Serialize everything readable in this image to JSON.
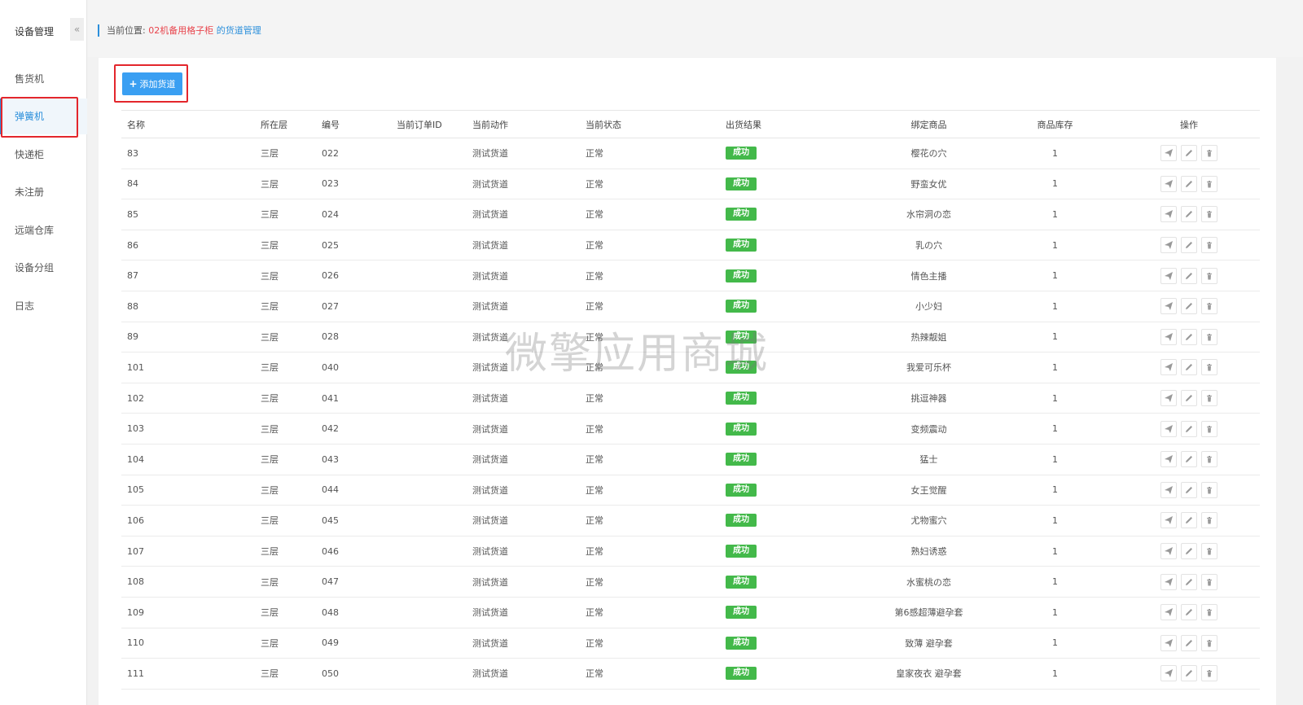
{
  "sidebar": {
    "title": "设备管理",
    "collapse_glyph": "«",
    "items": [
      {
        "label": "售货机"
      },
      {
        "label": "弹簧机"
      },
      {
        "label": "快递柜"
      },
      {
        "label": "未注册"
      },
      {
        "label": "远端仓库"
      },
      {
        "label": "设备分组"
      },
      {
        "label": "日志"
      }
    ],
    "active_index": 1
  },
  "breadcrumb": {
    "label": "当前位置:",
    "device": "02机备用格子柜",
    "page": "的货道管理"
  },
  "toolbar": {
    "add_label": "添加货道"
  },
  "table": {
    "headers": [
      "名称",
      "所在层",
      "编号",
      "当前订单ID",
      "当前动作",
      "当前状态",
      "出货结果",
      "绑定商品",
      "商品库存",
      "操作"
    ],
    "rows": [
      {
        "name": "83",
        "layer": "三层",
        "code": "022",
        "order_id": "",
        "action": "测试货道",
        "status": "正常",
        "result": "成功",
        "product": "樱花の穴",
        "stock": "1"
      },
      {
        "name": "84",
        "layer": "三层",
        "code": "023",
        "order_id": "",
        "action": "测试货道",
        "status": "正常",
        "result": "成功",
        "product": "野蛮女优",
        "stock": "1"
      },
      {
        "name": "85",
        "layer": "三层",
        "code": "024",
        "order_id": "",
        "action": "测试货道",
        "status": "正常",
        "result": "成功",
        "product": "水帘洞の恋",
        "stock": "1"
      },
      {
        "name": "86",
        "layer": "三层",
        "code": "025",
        "order_id": "",
        "action": "测试货道",
        "status": "正常",
        "result": "成功",
        "product": "乳の穴",
        "stock": "1"
      },
      {
        "name": "87",
        "layer": "三层",
        "code": "026",
        "order_id": "",
        "action": "测试货道",
        "status": "正常",
        "result": "成功",
        "product": "情色主播",
        "stock": "1"
      },
      {
        "name": "88",
        "layer": "三层",
        "code": "027",
        "order_id": "",
        "action": "测试货道",
        "status": "正常",
        "result": "成功",
        "product": "小少妇",
        "stock": "1"
      },
      {
        "name": "89",
        "layer": "三层",
        "code": "028",
        "order_id": "",
        "action": "测试货道",
        "status": "正常",
        "result": "成功",
        "product": "热辣靓姐",
        "stock": "1"
      },
      {
        "name": "101",
        "layer": "三层",
        "code": "040",
        "order_id": "",
        "action": "测试货道",
        "status": "正常",
        "result": "成功",
        "product": "我爱可乐杯",
        "stock": "1"
      },
      {
        "name": "102",
        "layer": "三层",
        "code": "041",
        "order_id": "",
        "action": "测试货道",
        "status": "正常",
        "result": "成功",
        "product": "挑逗神器",
        "stock": "1"
      },
      {
        "name": "103",
        "layer": "三层",
        "code": "042",
        "order_id": "",
        "action": "测试货道",
        "status": "正常",
        "result": "成功",
        "product": "变频震动",
        "stock": "1"
      },
      {
        "name": "104",
        "layer": "三层",
        "code": "043",
        "order_id": "",
        "action": "测试货道",
        "status": "正常",
        "result": "成功",
        "product": "猛士",
        "stock": "1"
      },
      {
        "name": "105",
        "layer": "三层",
        "code": "044",
        "order_id": "",
        "action": "测试货道",
        "status": "正常",
        "result": "成功",
        "product": "女王觉醒",
        "stock": "1"
      },
      {
        "name": "106",
        "layer": "三层",
        "code": "045",
        "order_id": "",
        "action": "测试货道",
        "status": "正常",
        "result": "成功",
        "product": "尤物蜜穴",
        "stock": "1"
      },
      {
        "name": "107",
        "layer": "三层",
        "code": "046",
        "order_id": "",
        "action": "测试货道",
        "status": "正常",
        "result": "成功",
        "product": "熟妇诱惑",
        "stock": "1"
      },
      {
        "name": "108",
        "layer": "三层",
        "code": "047",
        "order_id": "",
        "action": "测试货道",
        "status": "正常",
        "result": "成功",
        "product": "水蜜桃の恋",
        "stock": "1"
      },
      {
        "name": "109",
        "layer": "三层",
        "code": "048",
        "order_id": "",
        "action": "测试货道",
        "status": "正常",
        "result": "成功",
        "product": "第6感超薄避孕套",
        "stock": "1"
      },
      {
        "name": "110",
        "layer": "三层",
        "code": "049",
        "order_id": "",
        "action": "测试货道",
        "status": "正常",
        "result": "成功",
        "product": "致薄 避孕套",
        "stock": "1"
      },
      {
        "name": "111",
        "layer": "三层",
        "code": "050",
        "order_id": "",
        "action": "测试货道",
        "status": "正常",
        "result": "成功",
        "product": "皇家夜衣 避孕套",
        "stock": "1"
      }
    ]
  },
  "watermark": "微擎应用商城",
  "colors": {
    "accent": "#2b8fdb",
    "button": "#3a9ff2",
    "success": "#43b94a",
    "highlight": "#e3262c",
    "breadcrumb_device": "#e8434b"
  }
}
